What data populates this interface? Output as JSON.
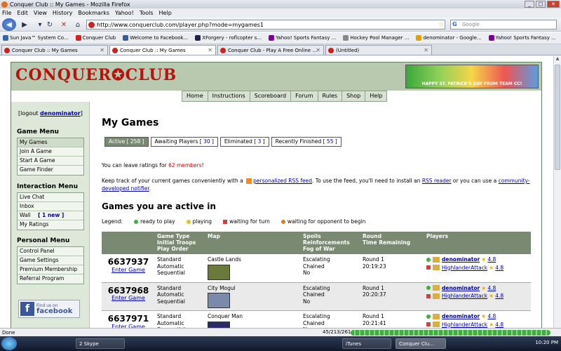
{
  "window": {
    "title": "Conquer Club :: My Games - Mozilla Firefox"
  },
  "menubar": [
    "File",
    "Edit",
    "View",
    "History",
    "Bookmarks",
    "Yahoo!",
    "Tools",
    "Help"
  ],
  "nav": {
    "url": "http://www.conquerclub.com/player.php?mode=mygames1",
    "search_placeholder": "Google"
  },
  "bookmarks": [
    {
      "label": "Sun Java™ System Co...",
      "color": "#3366aa"
    },
    {
      "label": "Conquer Club",
      "color": "#cc2222"
    },
    {
      "label": "Welcome to Facebook...",
      "color": "#3b5998"
    },
    {
      "label": "XForgery - roflcopter s...",
      "color": "#222244"
    },
    {
      "label": "Yahoo! Sports Fantasy ...",
      "color": "#7b0099"
    },
    {
      "label": "Hockey Pool Manager ...",
      "color": "#888888"
    },
    {
      "label": "denominator - Google...",
      "color": "#e0a000"
    },
    {
      "label": "Yahoo! Sports Fantasy ...",
      "color": "#7b0099"
    }
  ],
  "tabs": [
    {
      "label": "Conquer Club :: My Games",
      "active": false
    },
    {
      "label": "Conquer Club :: My Games",
      "active": true
    },
    {
      "label": "Conquer Club - Play A Free Online ...",
      "active": false
    },
    {
      "label": "(Untitled)",
      "active": false
    }
  ],
  "site": {
    "logo": "CONQUER✪CLUB",
    "banner": "HAPPY ST. PATRICK'S DAY FROM TEAM CC!",
    "topnav": [
      "Home",
      "Instructions",
      "Scoreboard",
      "Forum",
      "Rules",
      "Shop",
      "Help"
    ]
  },
  "sidebar": {
    "logout": "[logout ",
    "user": "denominator",
    "logout_end": "]",
    "game_menu_title": "Game Menu",
    "game_menu": [
      "My Games",
      "Join A Game",
      "Start A Game",
      "Game Finder"
    ],
    "interaction_menu_title": "Interaction Menu",
    "interaction_menu": [
      "Live Chat",
      "Inbox",
      "Wall",
      "My Ratings"
    ],
    "wall_new": "[ 1 new ]",
    "personal_menu_title": "Personal Menu",
    "personal_menu": [
      "Control Panel",
      "Game Settings",
      "Premium Membership",
      "Referral Program"
    ],
    "facebook_top": "Find us on",
    "facebook_name": "facebook"
  },
  "main": {
    "title": "My Games",
    "tabs": [
      {
        "label": "Active [ ",
        "count": "258",
        "end": " ]"
      },
      {
        "label": "Awaiting Players [ ",
        "count": "30",
        "end": " ]"
      },
      {
        "label": "Eliminated [ ",
        "count": "3",
        "end": " ]"
      },
      {
        "label": "Recently Finished [ ",
        "count": "55",
        "end": " ]"
      }
    ],
    "ratings_pre": "You can leave ratings for ",
    "ratings_count": "62 members",
    "ratings_post": "!",
    "rss_1": "Keep track of your current games conveniently with a ",
    "rss_link1": "personalized RSS feed",
    "rss_2": ". To use the feed, you'll need to install an ",
    "rss_link2": "RSS reader",
    "rss_3": " or you can use a ",
    "rss_link3": "community-developed notifier",
    "rss_4": ".",
    "active_title": "Games you are active in",
    "legend_label": "Legend:",
    "legend": [
      {
        "label": "ready to play",
        "color": "#3cb33c",
        "shape": "dot"
      },
      {
        "label": "playing",
        "color": "#e8c020",
        "shape": "dot"
      },
      {
        "label": "waiting for turn",
        "color": "#d04040",
        "shape": "sq"
      },
      {
        "label": "waiting for opponent to begin",
        "color": "#d08030",
        "shape": "dot"
      }
    ],
    "columns": {
      "game_type": "Game Type",
      "troops": "Initial Troops",
      "order": "Play Order",
      "map": "Map",
      "spoils": "Spoils",
      "reinf": "Reinforcements",
      "fog": "Fog of War",
      "round": "Round",
      "time": "Time Remaining",
      "players": "Players"
    },
    "enter_label": "Enter Game",
    "games": [
      {
        "id": "6637937",
        "type": "Standard",
        "troops": "Automatic",
        "order": "Sequential",
        "map": "Castle Lands",
        "map_color": "#6a7a3a",
        "spoils": "Escalating",
        "reinf": "Chained",
        "fog": "No",
        "round": "Round 1",
        "time": "20:19:23",
        "p1": "denominator",
        "p1r": "4.8",
        "p2": "HighlanderAttack",
        "p2r": "4.8"
      },
      {
        "id": "6637968",
        "type": "Standard",
        "troops": "Automatic",
        "order": "Sequential",
        "map": "City Mogul",
        "map_color": "#7a8aa8",
        "spoils": "Escalating",
        "reinf": "Chained",
        "fog": "No",
        "round": "Round 1",
        "time": "20:20:37",
        "p1": "denominator",
        "p1r": "4.8",
        "p2": "HighlanderAttack",
        "p2r": "4.8"
      },
      {
        "id": "6637971",
        "type": "Standard",
        "troops": "Automatic",
        "order": "Sequential",
        "map": "Conquer Man",
        "map_color": "#2a2a6a",
        "spoils": "Escalating",
        "reinf": "Chained",
        "fog": "No",
        "round": "Round 1",
        "time": "20:21:41",
        "p1": "denominator",
        "p1r": "4.8",
        "p2": "HighlanderAttack",
        "p2r": "4.8"
      }
    ]
  },
  "status": {
    "left": "Done",
    "count": "45/213/261"
  },
  "taskbar": {
    "items": [
      "2 Skype",
      "iTunes",
      "Conquer Clu..."
    ],
    "clock": "10:20 PM"
  }
}
